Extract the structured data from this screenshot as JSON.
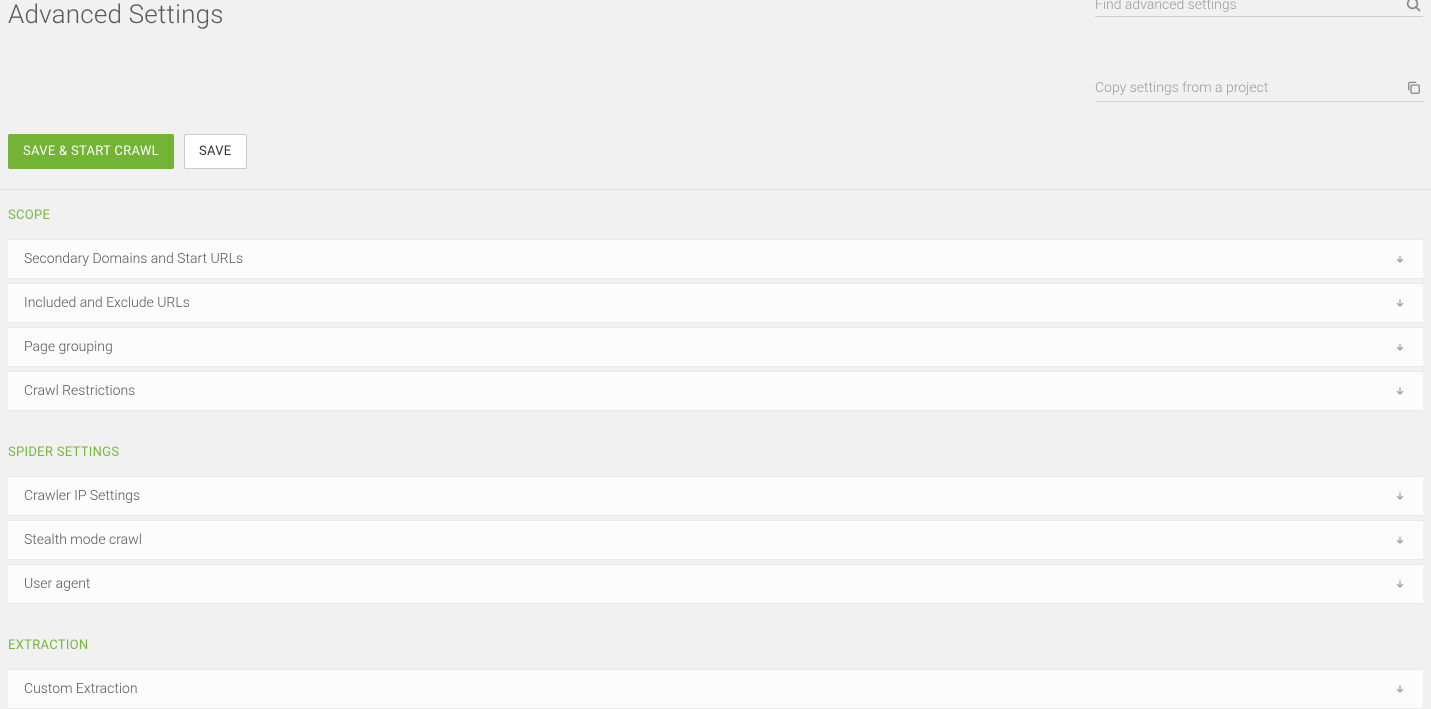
{
  "header": {
    "title": "Advanced Settings",
    "search": {
      "placeholder": "Find advanced settings"
    },
    "copy": {
      "placeholder": "Copy settings from a project"
    }
  },
  "buttons": {
    "save_start": "SAVE & START CRAWL",
    "save": "SAVE"
  },
  "sections": [
    {
      "title": "SCOPE",
      "items": [
        {
          "label": "Secondary Domains and Start URLs"
        },
        {
          "label": "Included and Exclude URLs"
        },
        {
          "label": "Page grouping"
        },
        {
          "label": "Crawl Restrictions"
        }
      ]
    },
    {
      "title": "SPIDER SETTINGS",
      "items": [
        {
          "label": "Crawler IP Settings"
        },
        {
          "label": "Stealth mode crawl"
        },
        {
          "label": "User agent"
        }
      ]
    },
    {
      "title": "EXTRACTION",
      "items": [
        {
          "label": "Custom Extraction"
        }
      ]
    }
  ]
}
